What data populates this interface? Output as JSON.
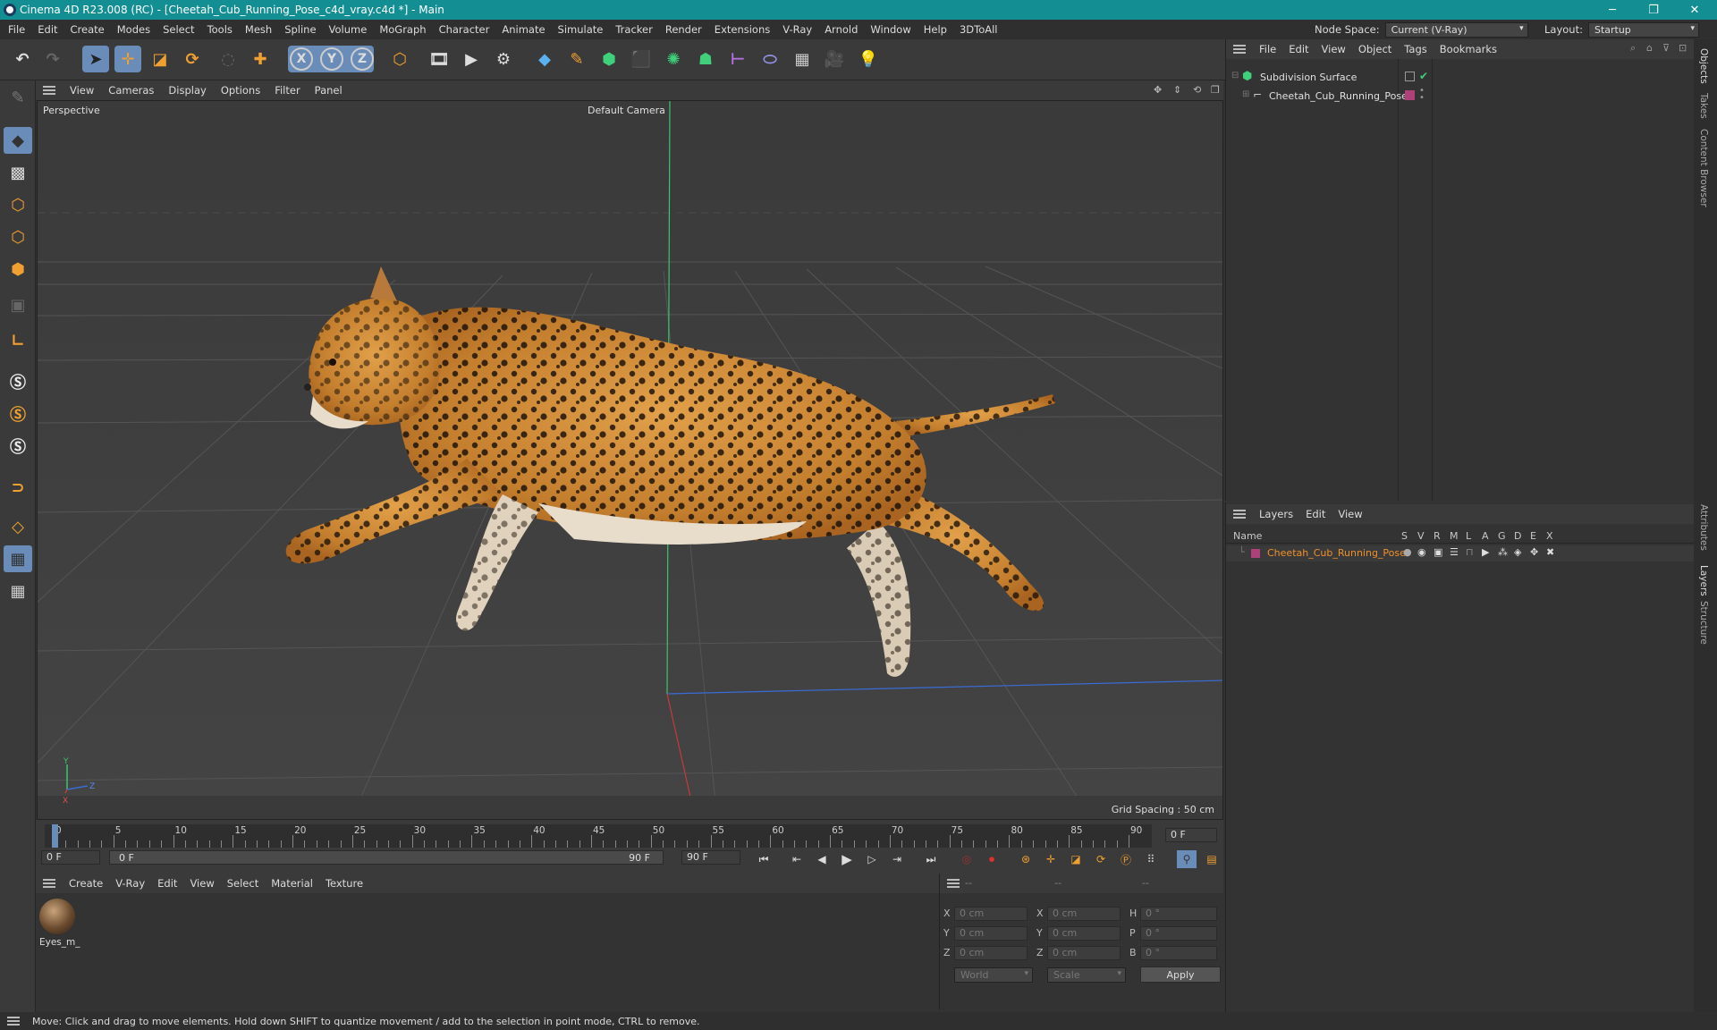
{
  "window": {
    "title": "Cinema 4D R23.008 (RC) - [Cheetah_Cub_Running_Pose_c4d_vray.c4d *] - Main",
    "minimize": "─",
    "maximize": "❐",
    "close": "✕"
  },
  "menubar": {
    "items": [
      "File",
      "Edit",
      "Create",
      "Modes",
      "Select",
      "Tools",
      "Mesh",
      "Spline",
      "Volume",
      "MoGraph",
      "Character",
      "Animate",
      "Simulate",
      "Tracker",
      "Render",
      "Extensions",
      "V-Ray",
      "Arnold",
      "Window",
      "Help",
      "3DToAll"
    ],
    "node_space_label": "Node Space:",
    "node_space_value": "Current (V-Ray)",
    "layout_label": "Layout:",
    "layout_value": "Startup"
  },
  "viewport": {
    "menu": [
      "View",
      "Cameras",
      "Display",
      "Options",
      "Filter",
      "Panel"
    ],
    "name": "Perspective",
    "camera": "Default Camera",
    "grid_spacing": "Grid Spacing : 50 cm",
    "axis_labels": {
      "y": "Y",
      "z": "Z",
      "x": "X"
    }
  },
  "timeline": {
    "ticks": [
      "0",
      "5",
      "10",
      "15",
      "20",
      "25",
      "30",
      "35",
      "40",
      "45",
      "50",
      "55",
      "60",
      "65",
      "70",
      "75",
      "80",
      "85",
      "90"
    ],
    "current_frame_right": "0 F",
    "start_field": "0 F",
    "range_start": "0 F",
    "range_end": "90 F",
    "end_field": "90 F",
    "playhead_fraction": 0.0
  },
  "material_manager": {
    "menu": [
      "Create",
      "V-Ray",
      "Edit",
      "View",
      "Select",
      "Material",
      "Texture"
    ],
    "materials": [
      {
        "name": "Eyes_m_"
      }
    ]
  },
  "coordinates": {
    "headers": [
      "--",
      "--",
      "--"
    ],
    "rows": [
      {
        "a_label": "X",
        "a_val": "0 cm",
        "b_label": "X",
        "b_val": "0 cm",
        "c_label": "H",
        "c_val": "0 °"
      },
      {
        "a_label": "Y",
        "a_val": "0 cm",
        "b_label": "Y",
        "b_val": "0 cm",
        "c_label": "P",
        "c_val": "0 °"
      },
      {
        "a_label": "Z",
        "a_val": "0 cm",
        "b_label": "Z",
        "b_val": "0 cm",
        "c_label": "B",
        "c_val": "0 °"
      }
    ],
    "world": "World",
    "scale": "Scale",
    "apply": "Apply"
  },
  "object_manager": {
    "menu": [
      "File",
      "Edit",
      "View",
      "Object",
      "Tags",
      "Bookmarks"
    ],
    "objects": [
      {
        "name": "Subdivision Surface"
      },
      {
        "name": "Cheetah_Cub_Running_Pose"
      }
    ]
  },
  "layer_manager": {
    "menu": [
      "Layers",
      "Edit",
      "View"
    ],
    "columns": [
      "Name",
      "S",
      "V",
      "R",
      "M",
      "L",
      "A",
      "G",
      "D",
      "E",
      "X"
    ],
    "layers": [
      {
        "name": "Cheetah_Cub_Running_Pose",
        "color": "#b0407a"
      }
    ]
  },
  "right_tabs": [
    "Objects",
    "Takes",
    "Content Browser",
    "Attributes",
    "Layers",
    "Structure"
  ],
  "status": "Move: Click and drag to move elements. Hold down SHIFT to quantize movement / add to the selection in point mode, CTRL to remove.",
  "colors": {
    "title_bar": "#138f94",
    "accent_orange": "#f0a030",
    "layer_name": "#f0902a",
    "selection_blue": "#6a8cb8"
  }
}
